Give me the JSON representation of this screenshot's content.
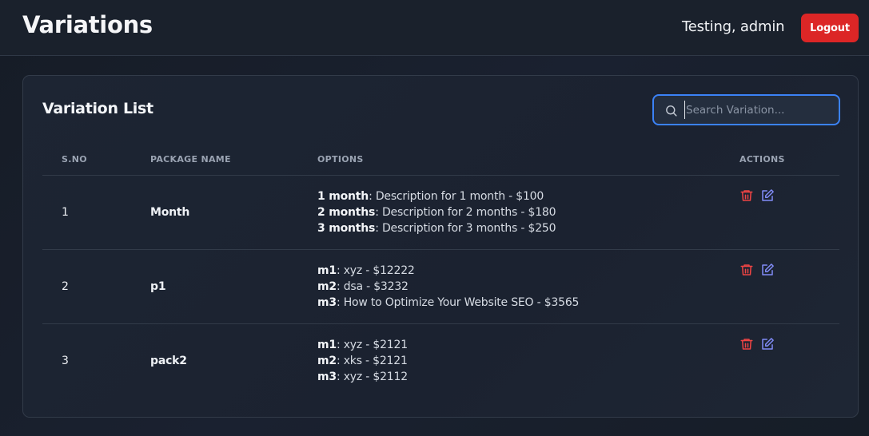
{
  "header": {
    "title": "Variations",
    "user": "Testing, admin",
    "logout_label": "Logout"
  },
  "card": {
    "title": "Variation List",
    "search": {
      "placeholder": "Search Variation...",
      "value": ""
    }
  },
  "table": {
    "columns": [
      "S.NO",
      "PACKAGE NAME",
      "OPTIONS",
      "ACTIONS"
    ],
    "rows": [
      {
        "sno": "1",
        "package": "Month",
        "options": [
          {
            "name": "1 month",
            "text": ": Description for 1 month - $100"
          },
          {
            "name": "2 months",
            "text": ": Description for 2 months - $180"
          },
          {
            "name": "3 months",
            "text": ": Description for 3 months - $250"
          }
        ]
      },
      {
        "sno": "2",
        "package": "p1",
        "options": [
          {
            "name": "m1",
            "text": ": xyz - $12222"
          },
          {
            "name": "m2",
            "text": ": dsa - $3232"
          },
          {
            "name": "m3",
            "text": ": How to Optimize Your Website SEO - $3565"
          }
        ]
      },
      {
        "sno": "3",
        "package": "pack2",
        "options": [
          {
            "name": "m1",
            "text": ": xyz - $2121"
          },
          {
            "name": "m2",
            "text": ": xks - $2121"
          },
          {
            "name": "m3",
            "text": ": xyz - $2112"
          }
        ]
      }
    ]
  },
  "icons": {
    "search": "search-icon",
    "delete": "trash-icon",
    "edit": "edit-icon"
  },
  "colors": {
    "accent": "#3b82f6",
    "danger": "#dc2626",
    "delete_icon": "#ef4444",
    "edit_icon": "#818cf8"
  }
}
